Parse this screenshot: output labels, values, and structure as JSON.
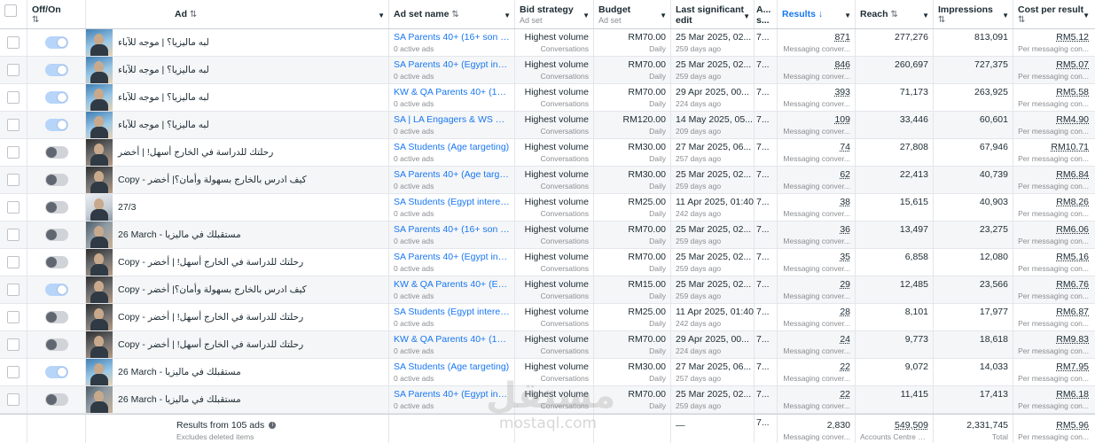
{
  "header": {
    "offon": "Off/On",
    "ad": "Ad",
    "adset": "Ad set name",
    "bid": "Bid strategy",
    "bid_sub": "Ad set",
    "budget": "Budget",
    "budget_sub": "Ad set",
    "edit": "Last significant edit",
    "a": "A... s...",
    "results": "Results",
    "reach": "Reach",
    "impressions": "Impressions",
    "cpr": "Cost per result",
    "sort_icon": "sort-icon",
    "sort_down_icon": "sort-down-icon"
  },
  "rows": [
    {
      "on": true,
      "thumb": "t1",
      "ad": "لبه ماليزيا؟ | موجه للآباء",
      "adset": "SA Parents 40+ (16+ son & d...",
      "adset_sub": "0 active ads",
      "bid": "Highest volume",
      "bid_sub": "Conversations",
      "budget": "RM70.00",
      "budget_sub": "Daily",
      "edit": "25 Mar 2025, 02...",
      "edit_sub": "259 days ago",
      "a": "7...",
      "results": "871",
      "results_sub": "Messaging conver...",
      "reach": "277,276",
      "impressions": "813,091",
      "cpr": "RM5.12",
      "cpr_sub": "Per messaging con..."
    },
    {
      "on": true,
      "thumb": "t1",
      "ad": "لبه ماليزيا؟ | موجه للآباء",
      "adset": "SA Parents 40+ (Egypt inter...",
      "adset_sub": "0 active ads",
      "bid": "Highest volume",
      "bid_sub": "Conversations",
      "budget": "RM70.00",
      "budget_sub": "Daily",
      "edit": "25 Mar 2025, 02...",
      "edit_sub": "259 days ago",
      "a": "7...",
      "results": "846",
      "results_sub": "Messaging conver...",
      "reach": "260,697",
      "impressions": "727,375",
      "cpr": "RM5.07",
      "cpr_sub": "Per messaging con..."
    },
    {
      "on": true,
      "thumb": "t1",
      "ad": "لبه ماليزيا؟ | موجه للآباء",
      "adset": "KW & QA Parents 40+ (16+ s...",
      "adset_sub": "0 active ads",
      "bid": "Highest volume",
      "bid_sub": "Conversations",
      "budget": "RM70.00",
      "budget_sub": "Daily",
      "edit": "29 Apr 2025, 00...",
      "edit_sub": "224 days ago",
      "a": "7...",
      "results": "393",
      "results_sub": "Messaging conver...",
      "reach": "71,173",
      "impressions": "263,925",
      "cpr": "RM5.58",
      "cpr_sub": "Per messaging con..."
    },
    {
      "on": true,
      "thumb": "t1",
      "ad": "لبه ماليزيا؟ | موجه للآباء",
      "adset": "SA | LA Engagers & WS Visit...",
      "adset_sub": "0 active ads",
      "bid": "Highest volume",
      "bid_sub": "Conversations",
      "budget": "RM120.00",
      "budget_sub": "Daily",
      "edit": "14 May 2025, 05...",
      "edit_sub": "209 days ago",
      "a": "7...",
      "results": "109",
      "results_sub": "Messaging conver...",
      "reach": "33,446",
      "impressions": "60,601",
      "cpr": "RM4.90",
      "cpr_sub": "Per messaging con..."
    },
    {
      "on": false,
      "thumb": "t2",
      "ad": "رحلتك للدراسة في الخارج أسهل! | أخضر",
      "adset": "SA Students (Age targeting)",
      "adset_sub": "0 active ads",
      "bid": "Highest volume",
      "bid_sub": "Conversations",
      "budget": "RM30.00",
      "budget_sub": "Daily",
      "edit": "27 Mar 2025, 06...",
      "edit_sub": "257 days ago",
      "a": "7...",
      "results": "74",
      "results_sub": "Messaging conver...",
      "reach": "27,808",
      "impressions": "67,946",
      "cpr": "RM10.71",
      "cpr_sub": "Per messaging con..."
    },
    {
      "on": false,
      "thumb": "t2",
      "ad": "كيف ادرس بالخارج بسهولة وأمان؟| أخضر - Copy",
      "adset": "SA Parents 40+ (Age targeti...",
      "adset_sub": "0 active ads",
      "bid": "Highest volume",
      "bid_sub": "Conversations",
      "budget": "RM30.00",
      "budget_sub": "Daily",
      "edit": "25 Mar 2025, 02...",
      "edit_sub": "259 days ago",
      "a": "7...",
      "results": "62",
      "results_sub": "Messaging conver...",
      "reach": "22,413",
      "impressions": "40,739",
      "cpr": "RM6.84",
      "cpr_sub": "Per messaging con..."
    },
    {
      "on": false,
      "thumb": "t3",
      "ad": "27/3",
      "adset": "SA Students (Egypt interest...",
      "adset_sub": "0 active ads",
      "bid": "Highest volume",
      "bid_sub": "Conversations",
      "budget": "RM25.00",
      "budget_sub": "Daily",
      "edit": "11 Apr 2025, 01:40",
      "edit_sub": "242 days ago",
      "a": "7...",
      "results": "38",
      "results_sub": "Messaging conver...",
      "reach": "15,615",
      "impressions": "40,903",
      "cpr": "RM8.26",
      "cpr_sub": "Per messaging con..."
    },
    {
      "on": false,
      "thumb": "t0",
      "ad": "26 March - مستقبلك في ماليزيا",
      "adset": "SA Parents 40+ (16+ son & d...",
      "adset_sub": "0 active ads",
      "bid": "Highest volume",
      "bid_sub": "Conversations",
      "budget": "RM70.00",
      "budget_sub": "Daily",
      "edit": "25 Mar 2025, 02...",
      "edit_sub": "259 days ago",
      "a": "7...",
      "results": "36",
      "results_sub": "Messaging conver...",
      "reach": "13,497",
      "impressions": "23,275",
      "cpr": "RM6.06",
      "cpr_sub": "Per messaging con..."
    },
    {
      "on": false,
      "thumb": "t2",
      "ad": "رحلتك للدراسة في الخارج أسهل! | أخضر - Copy",
      "adset": "SA Parents 40+ (Egypt inter...",
      "adset_sub": "0 active ads",
      "bid": "Highest volume",
      "bid_sub": "Conversations",
      "budget": "RM70.00",
      "budget_sub": "Daily",
      "edit": "25 Mar 2025, 02...",
      "edit_sub": "259 days ago",
      "a": "7...",
      "results": "35",
      "results_sub": "Messaging conver...",
      "reach": "6,858",
      "impressions": "12,080",
      "cpr": "RM5.16",
      "cpr_sub": "Per messaging con..."
    },
    {
      "on": true,
      "thumb": "t2",
      "ad": "كيف ادرس بالخارج بسهولة وأمان؟| أخضر - Copy",
      "adset": "KW & QA Parents 40+ (Egyp...",
      "adset_sub": "0 active ads",
      "bid": "Highest volume",
      "bid_sub": "Conversations",
      "budget": "RM15.00",
      "budget_sub": "Daily",
      "edit": "25 Mar 2025, 02...",
      "edit_sub": "259 days ago",
      "a": "7...",
      "results": "29",
      "results_sub": "Messaging conver...",
      "reach": "12,485",
      "impressions": "23,566",
      "cpr": "RM6.76",
      "cpr_sub": "Per messaging con..."
    },
    {
      "on": false,
      "thumb": "t2",
      "ad": "رحلتك للدراسة في الخارج أسهل! | أخضر - Copy",
      "adset": "SA Students (Egypt interest...",
      "adset_sub": "0 active ads",
      "bid": "Highest volume",
      "bid_sub": "Conversations",
      "budget": "RM25.00",
      "budget_sub": "Daily",
      "edit": "11 Apr 2025, 01:40",
      "edit_sub": "242 days ago",
      "a": "7...",
      "results": "28",
      "results_sub": "Messaging conver...",
      "reach": "8,101",
      "impressions": "17,977",
      "cpr": "RM6.87",
      "cpr_sub": "Per messaging con..."
    },
    {
      "on": false,
      "thumb": "t2",
      "ad": "رحلتك للدراسة في الخارج أسهل! | أخضر - Copy",
      "adset": "KW & QA Parents 40+ (16+ s...",
      "adset_sub": "0 active ads",
      "bid": "Highest volume",
      "bid_sub": "Conversations",
      "budget": "RM70.00",
      "budget_sub": "Daily",
      "edit": "29 Apr 2025, 00...",
      "edit_sub": "224 days ago",
      "a": "7...",
      "results": "24",
      "results_sub": "Messaging conver...",
      "reach": "9,773",
      "impressions": "18,618",
      "cpr": "RM9.83",
      "cpr_sub": "Per messaging con..."
    },
    {
      "on": true,
      "thumb": "t1",
      "ad": "26 March - مستقبلك في ماليزيا",
      "adset": "SA Students (Age targeting)",
      "adset_sub": "0 active ads",
      "bid": "Highest volume",
      "bid_sub": "Conversations",
      "budget": "RM30.00",
      "budget_sub": "Daily",
      "edit": "27 Mar 2025, 06...",
      "edit_sub": "257 days ago",
      "a": "7...",
      "results": "22",
      "results_sub": "Messaging conver...",
      "reach": "9,072",
      "impressions": "14,033",
      "cpr": "RM7.95",
      "cpr_sub": "Per messaging con..."
    },
    {
      "on": false,
      "thumb": "t0",
      "ad": "26 March - مستقبلك في ماليزيا",
      "adset": "SA Parents 40+ (Egypt inter...",
      "adset_sub": "0 active ads",
      "bid": "Highest volume",
      "bid_sub": "Conversations",
      "budget": "RM70.00",
      "budget_sub": "Daily",
      "edit": "25 Mar 2025, 02...",
      "edit_sub": "259 days ago",
      "a": "7...",
      "results": "22",
      "results_sub": "Messaging conver...",
      "reach": "11,415",
      "impressions": "17,413",
      "cpr": "RM6.18",
      "cpr_sub": "Per messaging con..."
    }
  ],
  "footer": {
    "results_from": "Results from 105 ads",
    "info_icon": "i",
    "excludes": "Excludes deleted items",
    "edit": "—",
    "a": "7...",
    "results": "2,830",
    "results_sub": "Messaging conver...",
    "reach": "549,509",
    "reach_sub": "Accounts Centre ac...",
    "impressions": "2,331,745",
    "impressions_sub": "Total",
    "cpr": "RM5.96",
    "cpr_sub": "Per messaging con..."
  },
  "watermark": {
    "arabic": "مستقل",
    "latin": "mostaql.com"
  },
  "colors": {
    "link": "#1877f2",
    "toggle_on": "#b7d4f9",
    "toggle_off": "#d0d3d7"
  }
}
